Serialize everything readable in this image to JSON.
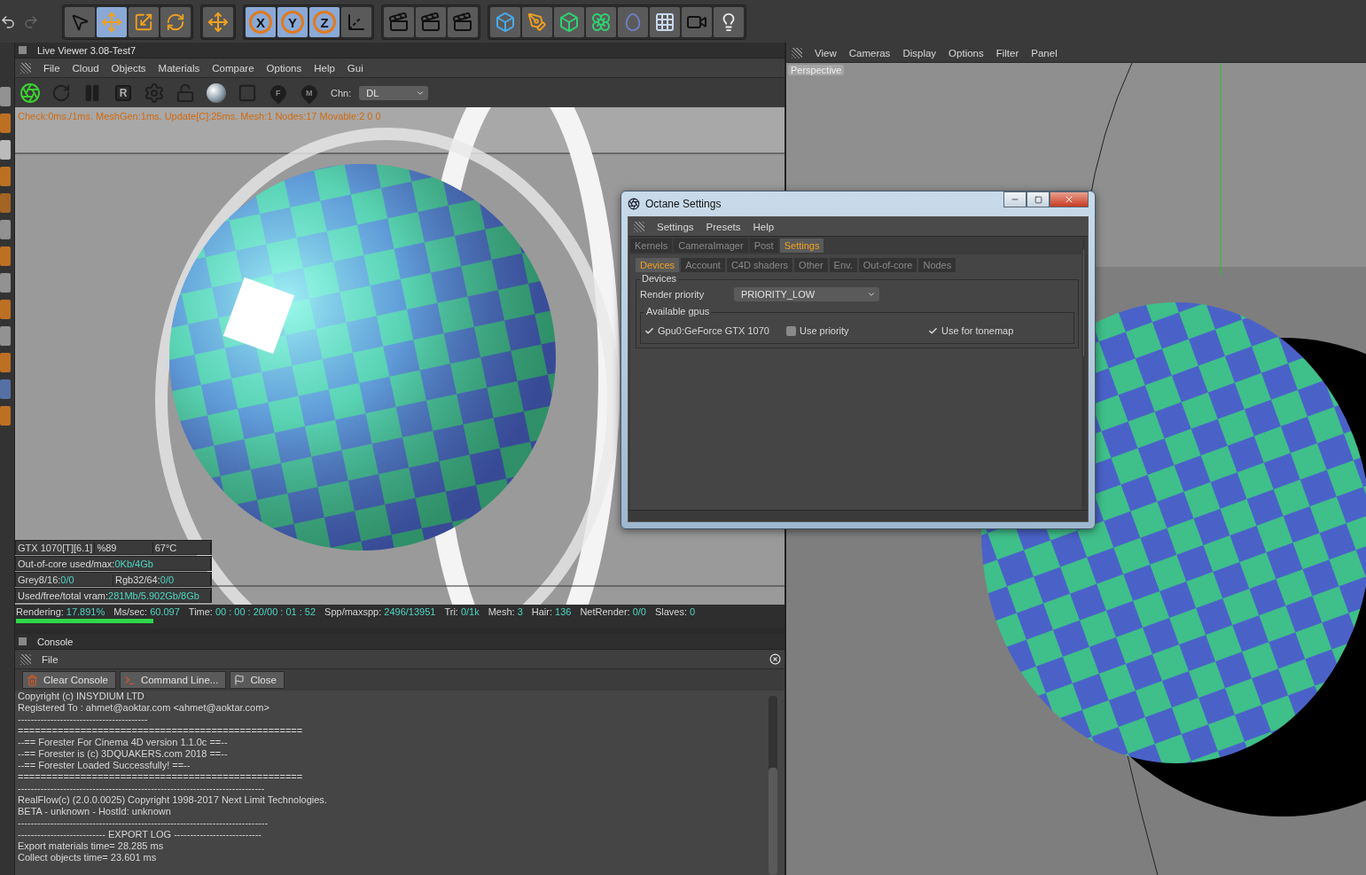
{
  "main_toolbar": {
    "groups": [
      {
        "tools": [
          {
            "kind": "pointer",
            "selected": false
          },
          {
            "kind": "move",
            "selected": true
          },
          {
            "kind": "scale",
            "selected": false
          },
          {
            "kind": "rotate",
            "selected": false
          }
        ]
      },
      {
        "tools": [
          {
            "kind": "move",
            "selected": false
          }
        ]
      },
      {
        "tools": [
          {
            "kind": "axis",
            "label": "X",
            "selected": true
          },
          {
            "kind": "axis",
            "label": "Y",
            "selected": true
          },
          {
            "kind": "axis",
            "label": "Z",
            "selected": true
          },
          {
            "kind": "coords",
            "selected": false
          }
        ]
      },
      {
        "tools": [
          {
            "kind": "render",
            "selected": false
          },
          {
            "kind": "render",
            "selected": false
          },
          {
            "kind": "render",
            "selected": false
          }
        ]
      },
      {
        "tools": [
          {
            "kind": "cube",
            "selected": false
          },
          {
            "kind": "pen",
            "selected": false
          },
          {
            "kind": "green-cube",
            "selected": false
          },
          {
            "kind": "flower",
            "selected": false
          },
          {
            "kind": "blob",
            "selected": false
          },
          {
            "kind": "floor",
            "selected": false
          },
          {
            "kind": "camera",
            "selected": false
          },
          {
            "kind": "light",
            "selected": false
          }
        ]
      }
    ]
  },
  "live_viewer": {
    "title": "Live Viewer 3.08-Test7",
    "menu": [
      "File",
      "Cloud",
      "Objects",
      "Materials",
      "Compare",
      "Options",
      "Help",
      "Gui"
    ],
    "tools": [
      {
        "kind": "aperture"
      },
      {
        "kind": "refresh"
      },
      {
        "kind": "pause"
      },
      {
        "kind": "letter",
        "label": "R"
      },
      {
        "kind": "gear"
      },
      {
        "kind": "lock"
      },
      {
        "kind": "sphere"
      },
      {
        "kind": "frame"
      },
      {
        "kind": "pin",
        "label": "F"
      },
      {
        "kind": "pin",
        "label": "M"
      }
    ],
    "channel": {
      "label": "Chn:",
      "value": "DL"
    },
    "info_line": "Check:0ms./1ms. MeshGen:1ms. Update[C]:25ms. Mesh:1 Nodes:17 Movable:2  0 0",
    "gpu_stats": [
      [
        {
          "label": "GTX 1070[T][6.1]"
        },
        {
          "label": "%89"
        },
        {
          "label": "67°C"
        }
      ],
      [
        {
          "label": "Out-of-core used/max:",
          "value": "0Kb/4Gb"
        }
      ],
      [
        {
          "label": "Grey8/16: ",
          "value": "0/0"
        },
        {
          "label": "Rgb32/64: ",
          "value": "0/0"
        }
      ],
      [
        {
          "label": "Used/free/total vram: ",
          "value": "281Mb/5.902Gb/8Gb"
        }
      ]
    ],
    "render_status": [
      {
        "label": "Rendering:",
        "value": "17.891%"
      },
      {
        "label": "Ms/sec:",
        "value": "60.097"
      },
      {
        "label": "Time:",
        "value": "00 : 00 : 20/00 : 01 : 52"
      },
      {
        "label": "Spp/maxspp:",
        "value": "2496/13951"
      },
      {
        "label": "Tri:",
        "value": "0/1k"
      },
      {
        "label": "Mesh:",
        "value": "3"
      },
      {
        "label": "Hair:",
        "value": "136"
      },
      {
        "label": "NetRender:",
        "value": "0/0"
      },
      {
        "label": "Slaves:",
        "value": "0"
      }
    ],
    "progress": {
      "level": 0.179
    }
  },
  "console": {
    "title": "Console",
    "menu": [
      "File"
    ],
    "buttons": [
      {
        "kind": "trash",
        "label": "Clear Console"
      },
      {
        "kind": "terminal",
        "label": "Command Line..."
      },
      {
        "kind": "flag",
        "label": "Close"
      }
    ],
    "lines": [
      {
        "text": "Copyright (c) INSYDIUM LTD"
      },
      {
        "text": "Registered To : ahmet@aoktar.com <ahmet@aoktar.com>"
      },
      {
        "text": "----------------------------------------"
      },
      {
        "text": "=================================================="
      },
      {
        "text": "--== Forester For Cinema 4D version 1.1.0c ==--"
      },
      {
        "text": "--== Forester is (c) 3DQUAKERS.com 2018 ==--"
      },
      {
        "text": "--== Forester Loaded Successfully! ==--"
      },
      {
        "text": "=================================================="
      },
      {
        "text": "----------------------------------------------------------------------------"
      },
      {
        "text": "RealFlow(c) (2.0.0.0025) Copyright 1998-2017 Next Limit Technologies."
      },
      {
        "text": "BETA - unknown - HostId: unknown"
      },
      {
        "text": "-----------------------------------------------------------------------------"
      },
      {
        "text": "--------------------------- EXPORT LOG ---------------------------"
      },
      {
        "text": "Export materials time= 28.285 ms"
      },
      {
        "text": "Collect objects time= 23.601 ms"
      }
    ]
  },
  "viewport": {
    "menu": [
      "View",
      "Cameras",
      "Display",
      "Options",
      "Filter",
      "Panel"
    ],
    "camera_label": "Perspective"
  },
  "octane_dialog": {
    "title": "Octane Settings",
    "menu": [
      "Settings",
      "Presets",
      "Help"
    ],
    "tabs": [
      {
        "label": "Kernels",
        "selected": false
      },
      {
        "label": "CameraImager",
        "selected": false
      },
      {
        "label": "Post",
        "selected": false
      },
      {
        "label": "Settings",
        "selected": true
      }
    ],
    "subtabs": [
      {
        "label": "Devices",
        "selected": true
      },
      {
        "label": "Account",
        "selected": false
      },
      {
        "label": "C4D shaders",
        "selected": false
      },
      {
        "label": "Other",
        "selected": false
      },
      {
        "label": "Env.",
        "selected": false
      },
      {
        "label": "Out-of-core",
        "selected": false
      },
      {
        "label": "Nodes",
        "selected": false
      }
    ],
    "devices_group": "Devices",
    "render_priority": {
      "label": "Render priority",
      "value": "PRIORITY_LOW"
    },
    "gpus_group": "Available gpus",
    "gpu_options": [
      {
        "label": "Gpu0:GeForce GTX 1070",
        "checked": true
      },
      {
        "label": "Use priority",
        "checked": false
      },
      {
        "label": "Use for tonemap",
        "checked": true
      }
    ]
  }
}
